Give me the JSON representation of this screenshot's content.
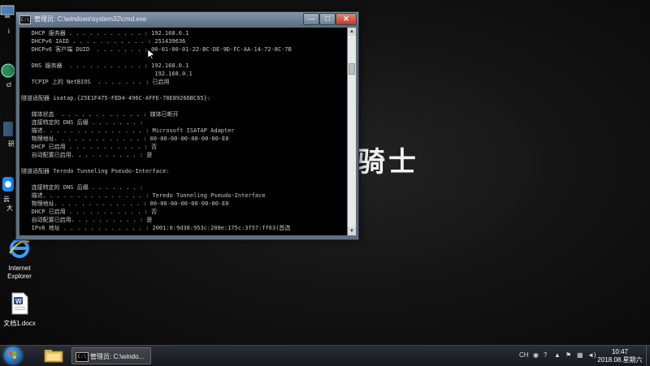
{
  "desktop": {
    "icons": [
      {
        "name": "internet-explorer",
        "label_line1": "Internet",
        "label_line2": "Explorer"
      },
      {
        "name": "word-document",
        "label_line1": "文档1.docx",
        "label_line2": ""
      }
    ],
    "partial_labels": [
      "i",
      "cl",
      "研",
      "云",
      "大"
    ],
    "wallpaper_text": "骑士"
  },
  "cmd_window": {
    "title": "管理员: C:\\windows\\system32\\cmd.exe",
    "lines": [
      "   DHCP 服务器 . . . . . . . . . . . : 192.168.0.1",
      "   DHCPv6 IAID . . . . . . . . . . . : 251439636",
      "   DHCPv6 客户端 DUID  . . . . . . . : 00-01-00-01-22-BC-DE-9D-FC-AA-14-72-8C-7B",
      "",
      "   DNS 服务器  . . . . . . . . . . . : 192.168.0.1",
      "                                       192.168.0.1",
      "   TCPIP 上的 NetBIOS  . . . . . . . : 已启用",
      "",
      "隧道适配器 isatap.{25E1F475-FED4-496C-AFFE-78E89266BC65}:",
      "",
      "   媒体状态  . . . . . . . . . . . . : 媒体已断开",
      "   连接特定的 DNS 后缀 . . . . . . . :",
      "   描述. . . . . . . . . . . . . . . : Microsoft ISATAP Adapter",
      "   物理地址. . . . . . . . . . . . . : 00-00-00-00-00-00-00-E0",
      "   DHCP 已启用 . . . . . . . . . . . : 否",
      "   自动配置已启用. . . . . . . . . . : 是",
      "",
      "隧道适配器 Teredo Tunneling Pseudo-Interface:",
      "",
      "   连接特定的 DNS 后缀 . . . . . . . :",
      "   描述. . . . . . . . . . . . . . . : Teredo Tunneling Pseudo-Interface",
      "   物理地址. . . . . . . . . . . . . : 00-00-00-00-00-00-00-E0",
      "   DHCP 已启用 . . . . . . . . . . . : 否",
      "   自动配置已启用. . . . . . . . . . : 是",
      "   IPv6 地址 . . . . . . . . . . . . : 2001:0:9d38:953c:208e:175c:3f57:ff63(首选"
    ],
    "buttons": {
      "minimize": "—",
      "maximize": "□",
      "close": "✕"
    }
  },
  "taskbar": {
    "cmd_task_label": "管理员: C:\\windo...",
    "tray": {
      "lang": "CH"
    },
    "clock": {
      "time": "10:47",
      "date": "2018.08.星期六"
    }
  },
  "colors": {
    "console_bg": "#000000",
    "console_fg": "#c8c8c8",
    "titlebar": "#6e8296"
  }
}
